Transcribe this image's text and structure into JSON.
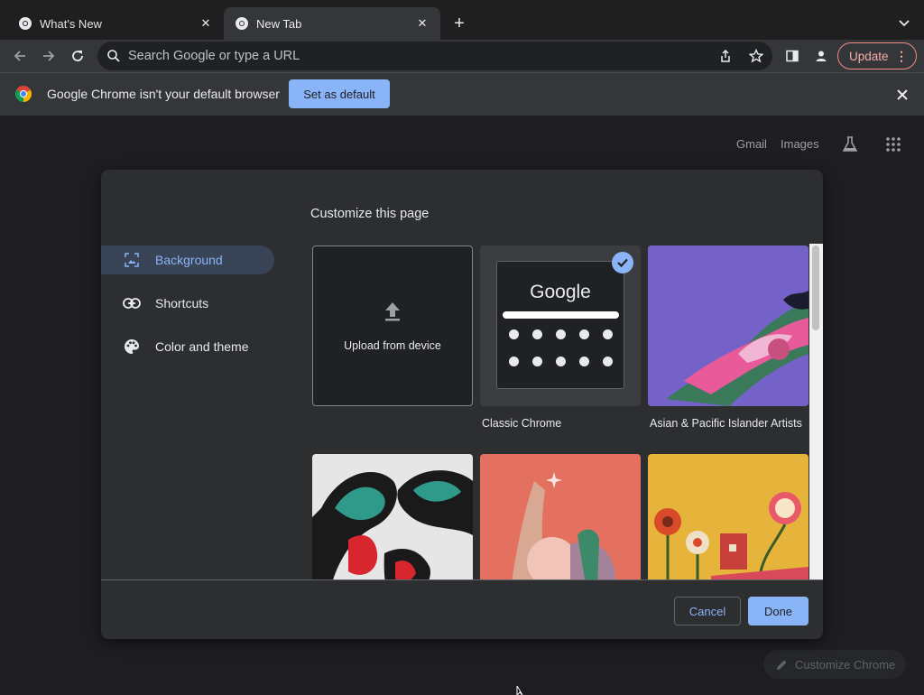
{
  "tabs": [
    {
      "title": "What's New",
      "active": false
    },
    {
      "title": "New Tab",
      "active": true
    }
  ],
  "toolbar": {
    "omnibox_placeholder": "Search Google or type a URL",
    "update_label": "Update"
  },
  "infobar": {
    "message": "Google Chrome isn't your default browser",
    "button_label": "Set as default"
  },
  "ntp": {
    "links": [
      "Gmail",
      "Images"
    ],
    "customize_label": "Customize Chrome"
  },
  "dialog": {
    "title": "Customize this page",
    "sidebar": [
      {
        "label": "Background",
        "icon": "image-icon",
        "selected": true
      },
      {
        "label": "Shortcuts",
        "icon": "link-icon",
        "selected": false
      },
      {
        "label": "Color and theme",
        "icon": "palette-icon",
        "selected": false
      }
    ],
    "tiles": [
      {
        "label": "Upload from device",
        "type": "upload"
      },
      {
        "label": "Classic Chrome",
        "type": "classic",
        "selected": true,
        "logo_text": "Google"
      },
      {
        "label": "Asian & Pacific Islander Artists",
        "type": "image",
        "color": "#6f5cc2"
      },
      {
        "label": "",
        "type": "image",
        "color": "#e8e8e8"
      },
      {
        "label": "",
        "type": "image",
        "color": "#e4705f"
      },
      {
        "label": "",
        "type": "image",
        "color": "#e8b83a"
      }
    ],
    "cancel_label": "Cancel",
    "done_label": "Done"
  },
  "colors": {
    "accent": "#8ab4f8",
    "update_outline": "#f28b82",
    "toolbar_bg": "#35363a"
  }
}
